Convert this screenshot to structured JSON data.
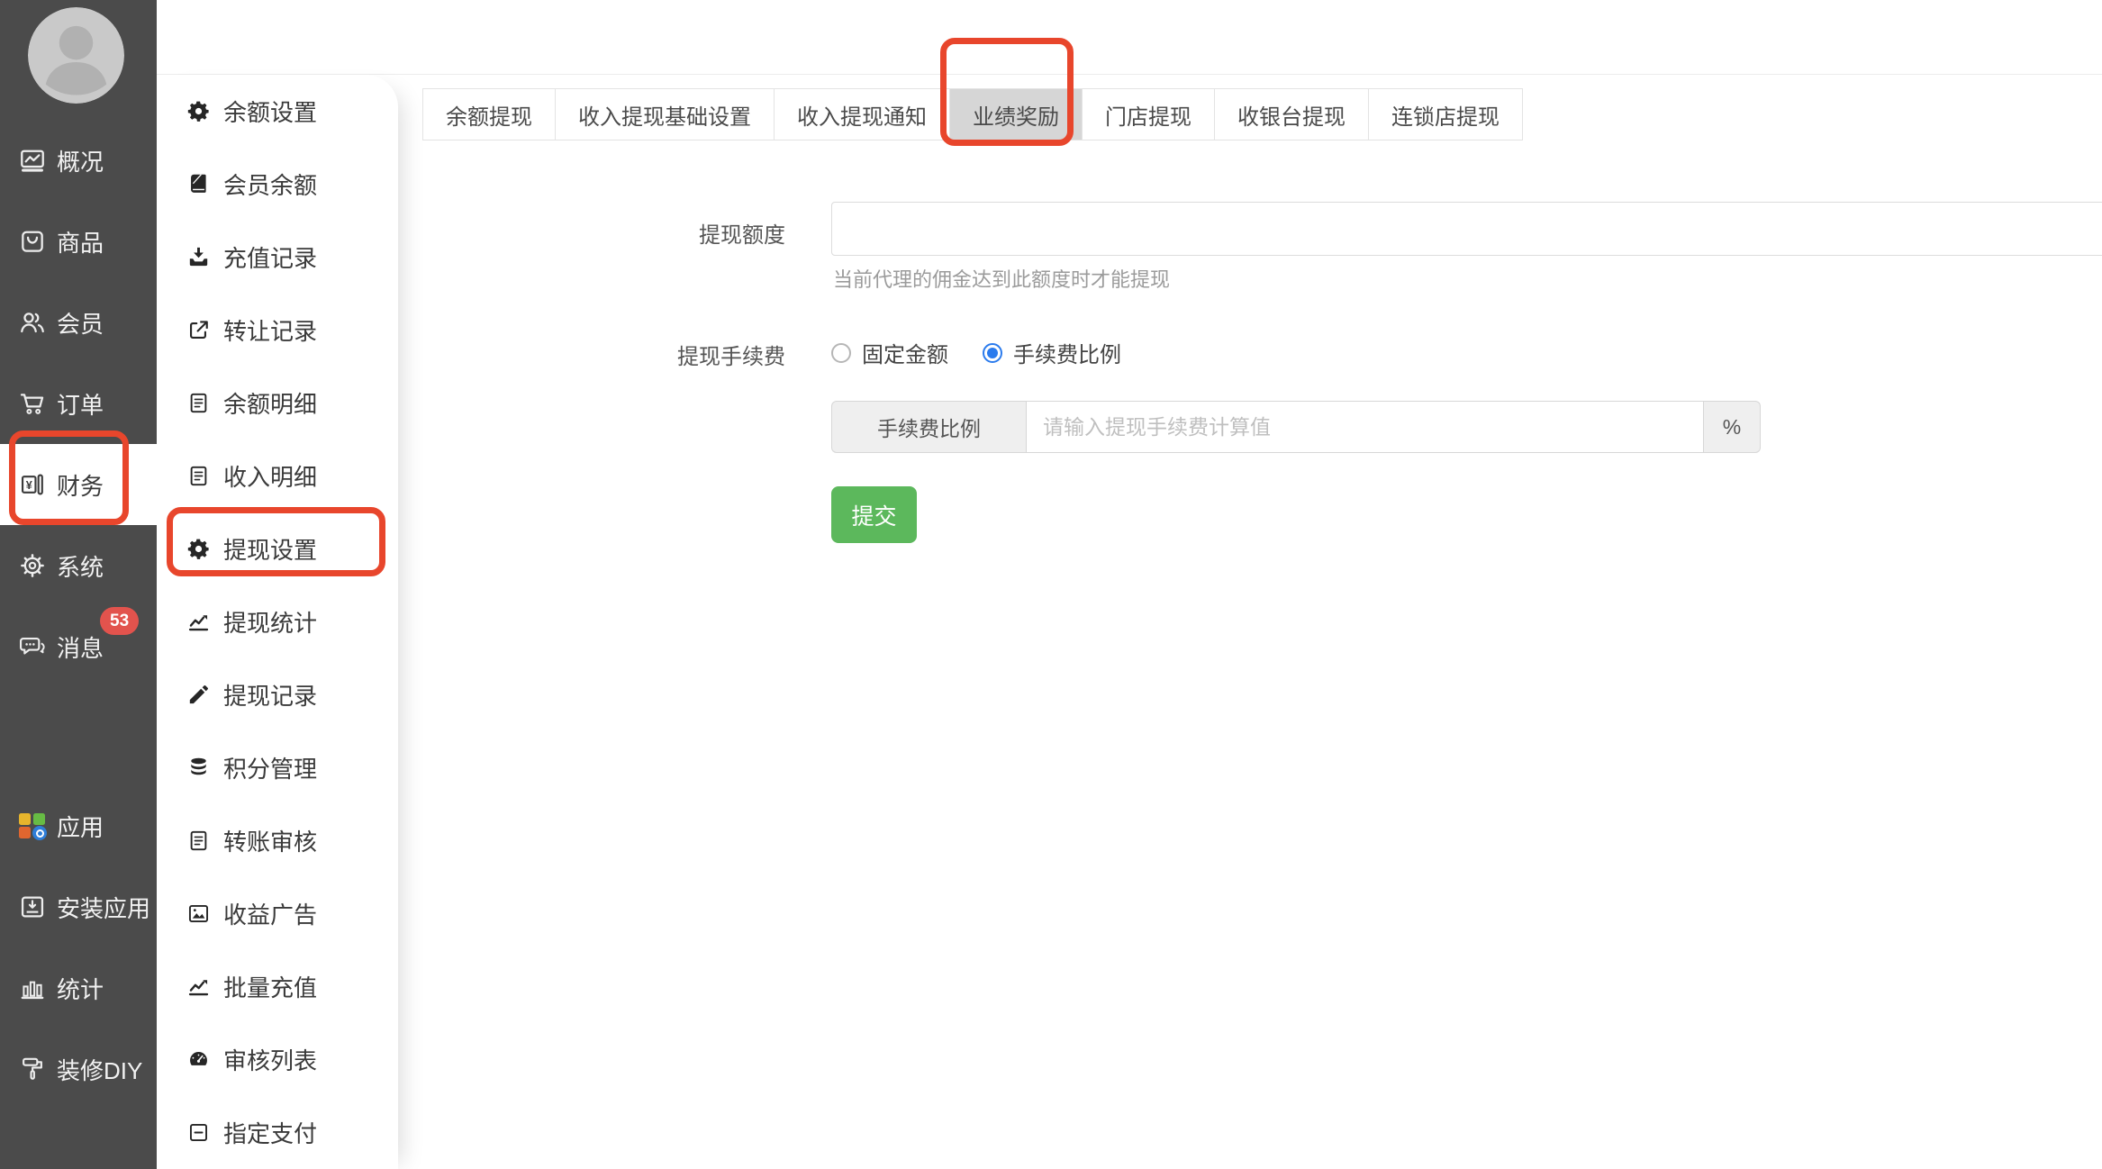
{
  "app": {
    "colors": {
      "sidebar_bg": "#4b4b4b",
      "annotation_red": "#e8462c",
      "badge_red": "#e2534d",
      "active_tab_gray": "#d6d6d6",
      "radio_blue": "#2b7bed",
      "submit_green": "#5cb85c"
    }
  },
  "sidebar_primary": {
    "items": [
      {
        "label": "概况",
        "icon": "overview-monitor-icon"
      },
      {
        "label": "商品",
        "icon": "goods-bag-icon"
      },
      {
        "label": "会员",
        "icon": "members-users-icon"
      },
      {
        "label": "订单",
        "icon": "orders-cart-icon"
      },
      {
        "label": "财务",
        "icon": "finance-wallet-icon",
        "active": true,
        "annotated": true
      },
      {
        "label": "系统",
        "icon": "system-gear-icon"
      },
      {
        "label": "消息",
        "icon": "messages-chat-icon",
        "badge": "53"
      },
      {
        "label": "应用",
        "icon": "apps-grid-icon"
      },
      {
        "label": "安装应用",
        "icon": "install-app-icon"
      },
      {
        "label": "统计",
        "icon": "stats-bars-icon"
      },
      {
        "label": "装修DIY",
        "icon": "decorate-roller-icon"
      }
    ]
  },
  "sidebar_secondary": {
    "items": [
      {
        "label": "余额设置",
        "icon": "gear-icon"
      },
      {
        "label": "会员余额",
        "icon": "book-icon"
      },
      {
        "label": "充值记录",
        "icon": "download-icon"
      },
      {
        "label": "转让记录",
        "icon": "external-link-icon"
      },
      {
        "label": "余额明细",
        "icon": "document-icon"
      },
      {
        "label": "收入明细",
        "icon": "document-icon"
      },
      {
        "label": "提现设置",
        "icon": "gear-icon",
        "annotated": true
      },
      {
        "label": "提现统计",
        "icon": "chart-line-icon"
      },
      {
        "label": "提现记录",
        "icon": "pencil-icon"
      },
      {
        "label": "积分管理",
        "icon": "database-icon"
      },
      {
        "label": "转账审核",
        "icon": "document-icon"
      },
      {
        "label": "收益广告",
        "icon": "image-icon"
      },
      {
        "label": "批量充值",
        "icon": "chart-line-icon"
      },
      {
        "label": "审核列表",
        "icon": "dashboard-icon"
      },
      {
        "label": "指定支付",
        "icon": "minus-square-icon"
      }
    ]
  },
  "tabs": {
    "items": [
      {
        "label": "余额提现"
      },
      {
        "label": "收入提现基础设置"
      },
      {
        "label": "收入提现通知"
      },
      {
        "label": "业绩奖励",
        "active": true,
        "annotated": true
      },
      {
        "label": "门店提现"
      },
      {
        "label": "收银台提现"
      },
      {
        "label": "连锁店提现"
      }
    ]
  },
  "form": {
    "withdraw_quota": {
      "label": "提现额度",
      "value": "",
      "help": "当前代理的佣金达到此额度时才能提现"
    },
    "withdraw_fee": {
      "label": "提现手续费",
      "options": [
        {
          "label": "固定金额",
          "checked": false
        },
        {
          "label": "手续费比例",
          "checked": true
        }
      ],
      "rate_addon": "手续费比例",
      "rate_placeholder": "请输入提现手续费计算值",
      "rate_suffix": "%"
    },
    "submit_label": "提交"
  }
}
